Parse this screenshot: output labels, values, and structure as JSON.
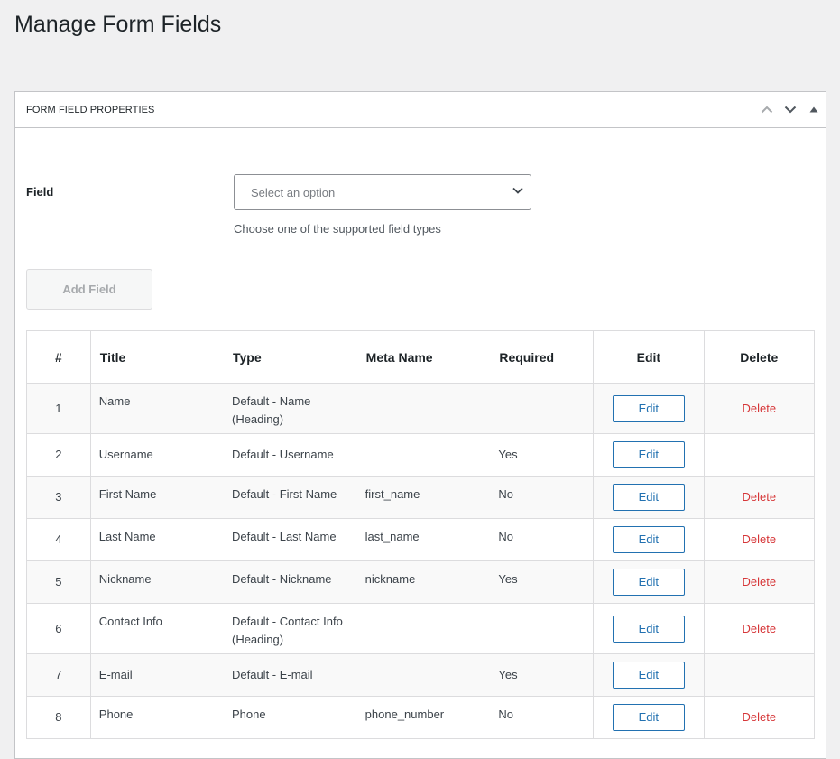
{
  "page": {
    "title": "Manage Form Fields"
  },
  "panel": {
    "title": "FORM FIELD PROPERTIES",
    "icons": [
      "chevron-up-icon",
      "chevron-down-icon",
      "collapse-triangle-icon"
    ]
  },
  "form": {
    "field_label": "Field",
    "select_placeholder": "Select an option",
    "description": "Choose one of the supported field types",
    "add_button": "Add Field"
  },
  "table": {
    "headers": {
      "num": "#",
      "title": "Title",
      "type": "Type",
      "meta": "Meta Name",
      "required": "Required",
      "edit": "Edit",
      "delete": "Delete"
    },
    "rows": [
      {
        "num": "1",
        "title": "Name",
        "type": "Default - Name (Heading)",
        "meta": "",
        "required": "",
        "edit": "Edit",
        "delete": "Delete"
      },
      {
        "num": "2",
        "title": "Username",
        "type": "Default - Username",
        "meta": "",
        "required": "Yes",
        "edit": "Edit",
        "delete": ""
      },
      {
        "num": "3",
        "title": "First Name",
        "type": "Default - First Name",
        "meta": "first_name",
        "required": "No",
        "edit": "Edit",
        "delete": "Delete"
      },
      {
        "num": "4",
        "title": "Last Name",
        "type": "Default - Last Name",
        "meta": "last_name",
        "required": "No",
        "edit": "Edit",
        "delete": "Delete"
      },
      {
        "num": "5",
        "title": "Nickname",
        "type": "Default - Nickname",
        "meta": "nickname",
        "required": "Yes",
        "edit": "Edit",
        "delete": "Delete"
      },
      {
        "num": "6",
        "title": "Contact Info",
        "type": "Default - Contact Info (Heading)",
        "meta": "",
        "required": "",
        "edit": "Edit",
        "delete": "Delete"
      },
      {
        "num": "7",
        "title": "E-mail",
        "type": "Default - E-mail",
        "meta": "",
        "required": "Yes",
        "edit": "Edit",
        "delete": ""
      },
      {
        "num": "8",
        "title": "Phone",
        "type": "Phone",
        "meta": "phone_number",
        "required": "No",
        "edit": "Edit",
        "delete": "Delete"
      }
    ]
  },
  "colors": {
    "accent": "#2271b1",
    "delete": "#d63638",
    "background": "#f0f0f1"
  }
}
